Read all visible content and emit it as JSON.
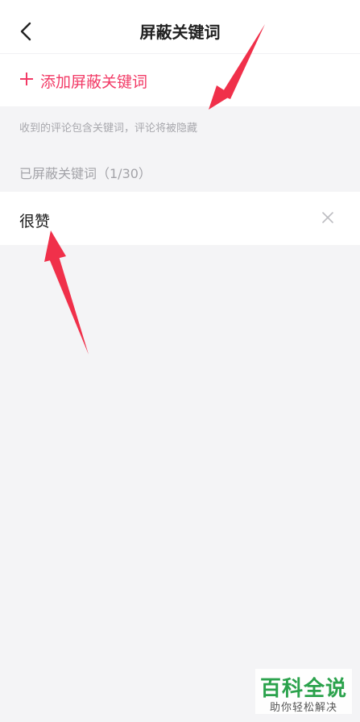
{
  "header": {
    "title": "屏蔽关键词",
    "back_icon": "chevron-left-icon"
  },
  "add_keyword": {
    "icon": "plus-icon",
    "label": "添加屏蔽关键词",
    "color": "#f23a66"
  },
  "hint": "收到的评论包含关键词，评论将被隐藏",
  "blocked_section": {
    "title": "已屏蔽关键词（1/30）",
    "items": [
      {
        "keyword": "很赞",
        "remove_icon": "close-icon"
      }
    ]
  },
  "annotation": {
    "arrow_color": "#f0304a"
  },
  "watermark": {
    "title": "百科全说",
    "subtitle": "助你轻松解决",
    "color": "#2ba24c"
  }
}
